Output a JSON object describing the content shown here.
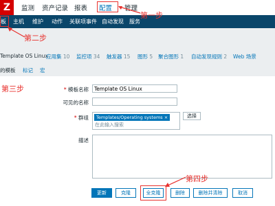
{
  "top_nav": {
    "items": [
      "监测",
      "资产记录",
      "报表",
      "配置",
      "管理"
    ],
    "active": "配置"
  },
  "sub_nav": {
    "items": [
      "板",
      "主机",
      "维护",
      "动作",
      "关联项事件",
      "自动发现",
      "服务"
    ]
  },
  "template_tabs": [
    {
      "label": "Template OS Linux",
      "count": ""
    },
    {
      "label": "应用集",
      "count": "10"
    },
    {
      "label": "监控项",
      "count": "34"
    },
    {
      "label": "触发器",
      "count": "15"
    },
    {
      "label": "图形",
      "count": "5"
    },
    {
      "label": "聚合图形",
      "count": "1"
    },
    {
      "label": "自动发现规则",
      "count": "2"
    },
    {
      "label": "Web 场景",
      "count": ""
    }
  ],
  "form_tabs": [
    "的模板",
    "标记",
    "宏"
  ],
  "form": {
    "template_name_label": "模板名称",
    "template_name_value": "Template OS Linux",
    "visible_name_label": "可见的名称",
    "visible_name_value": "",
    "group_label": "群组",
    "group_chip": "Templates/Operating systems",
    "group_placeholder": "在此输入搜索",
    "select_label": "选择",
    "description_label": "描述",
    "description_value": ""
  },
  "buttons": {
    "update": "更新",
    "clone": "克隆",
    "full_clone": "全克隆",
    "delete": "删除",
    "delete_clear": "删除并清除",
    "cancel": "取消"
  },
  "annotations": {
    "step1": "第一步",
    "step2": "第二步",
    "step3": "第三步",
    "step4": "第四步"
  },
  "colors": {
    "annotation": "#e8312d",
    "header_dark": "#0a466a",
    "link": "#0275b8"
  }
}
